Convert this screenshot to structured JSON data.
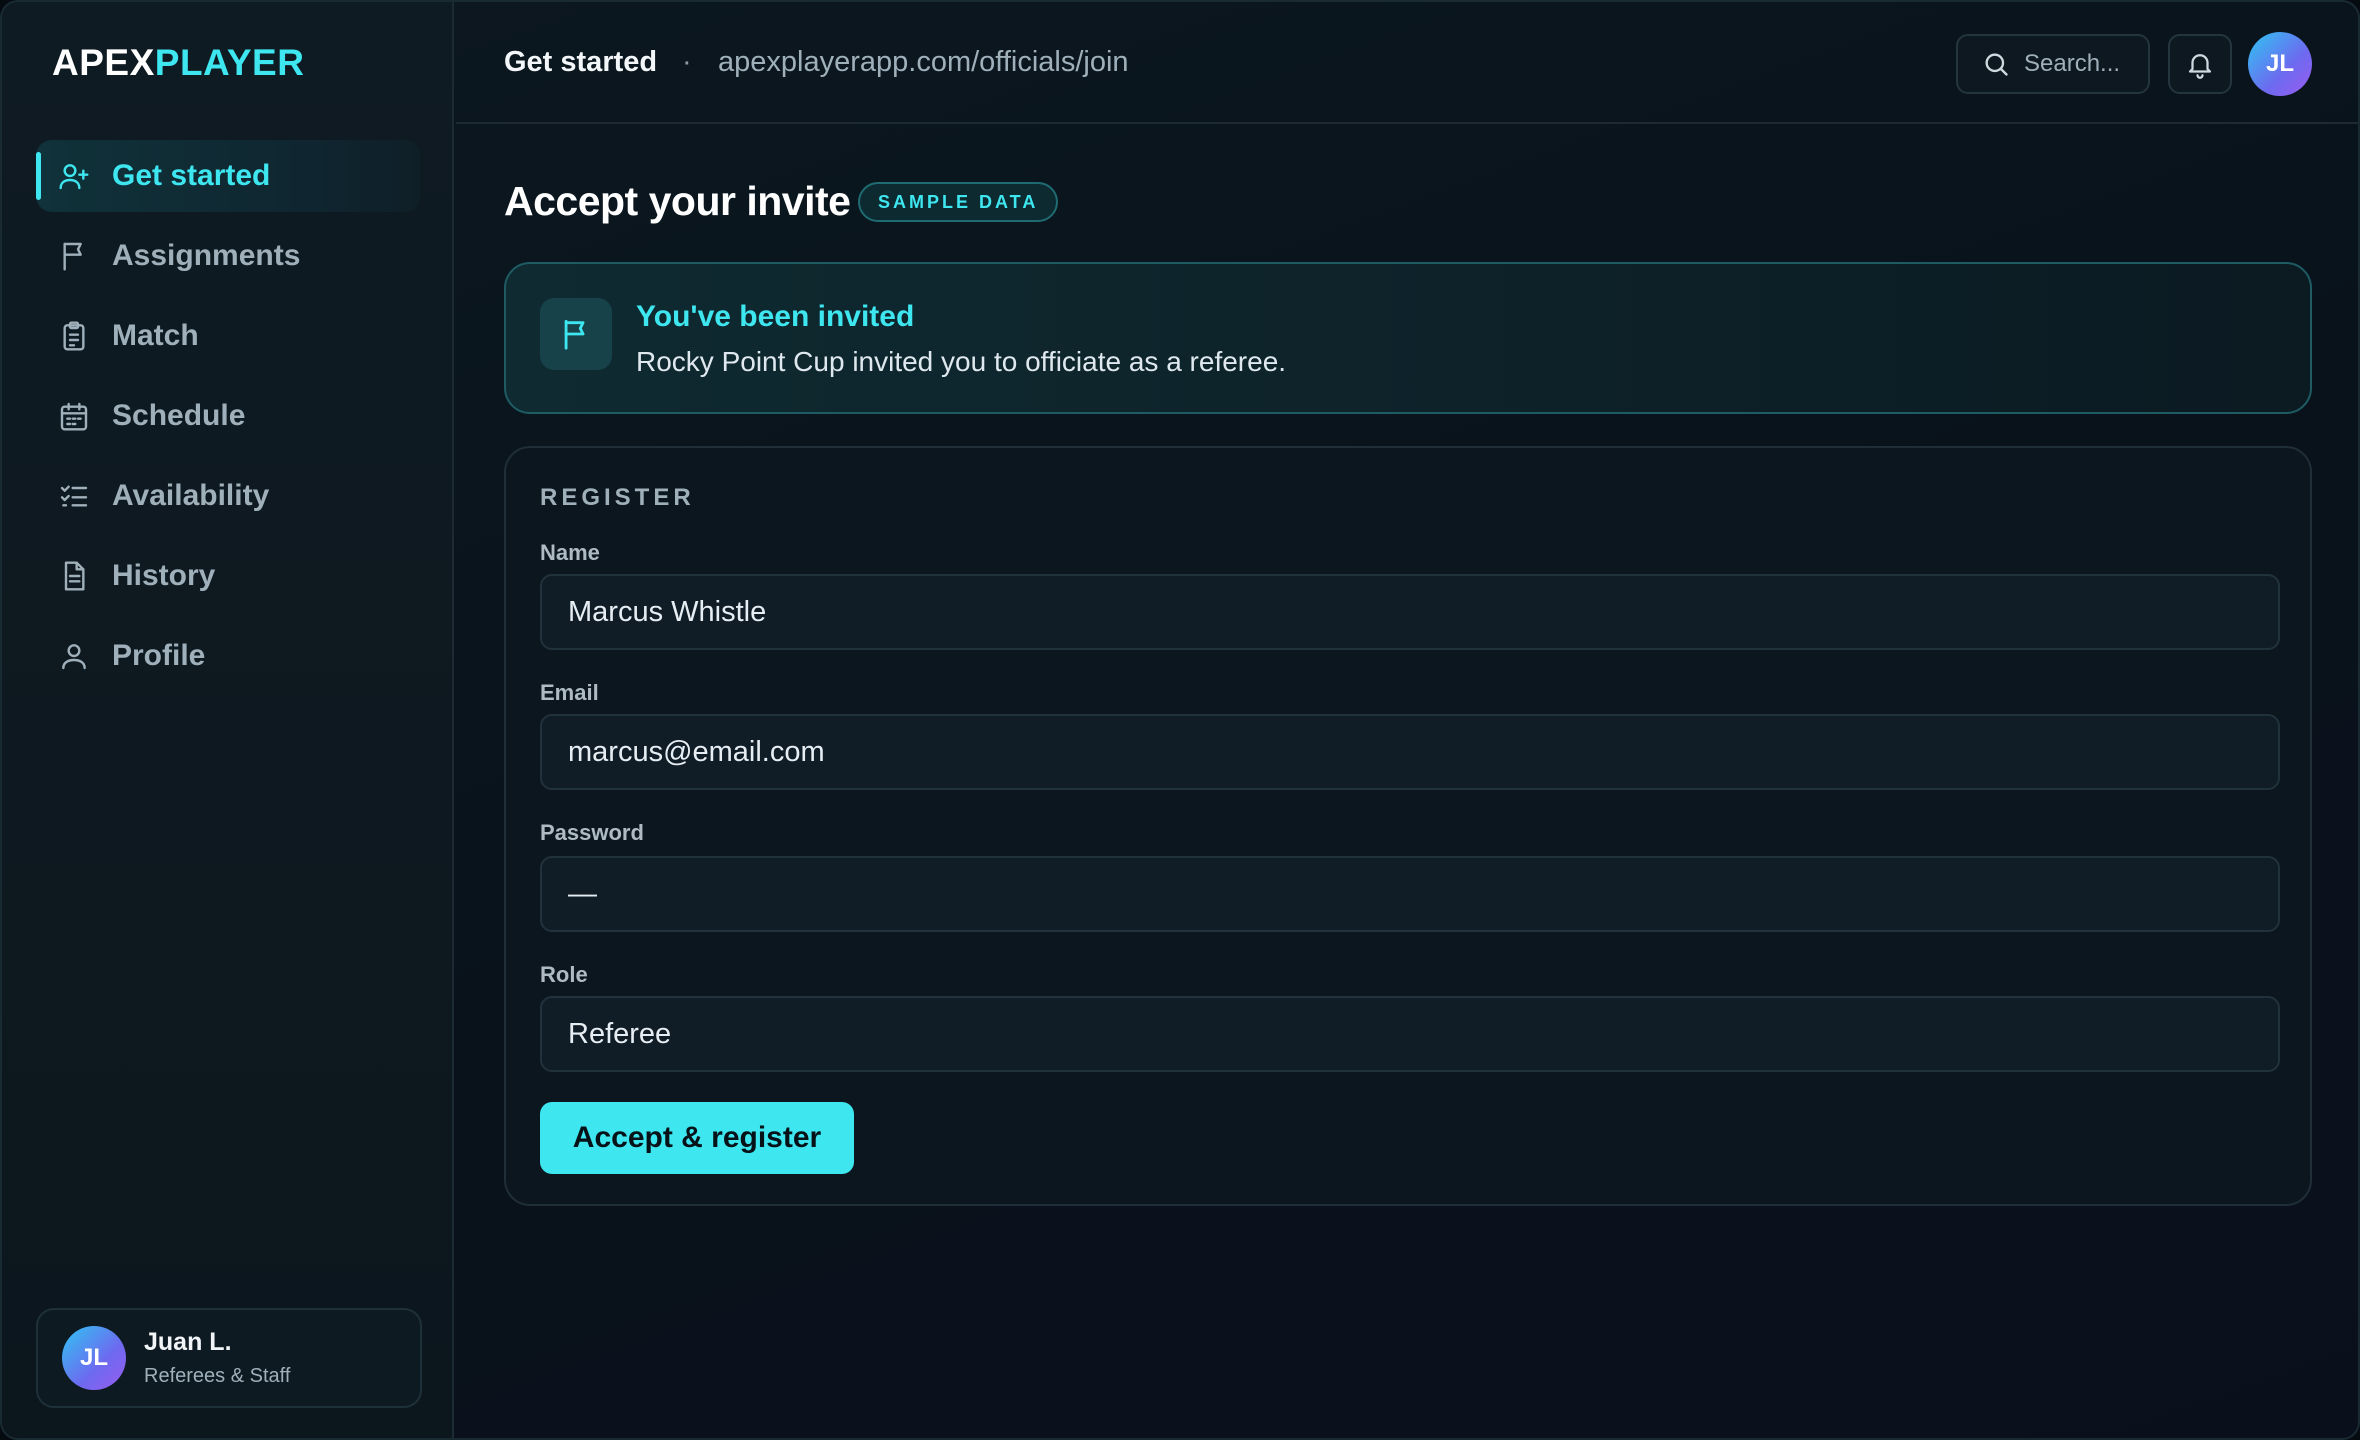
{
  "brand": {
    "part1": "APEX",
    "part2": "PLAYER"
  },
  "sidebar": {
    "items": [
      {
        "label": "Get started",
        "icon": "user-plus-icon",
        "active": true
      },
      {
        "label": "Assignments",
        "icon": "flag-icon",
        "active": false
      },
      {
        "label": "Match",
        "icon": "clipboard-icon",
        "active": false
      },
      {
        "label": "Schedule",
        "icon": "calendar-icon",
        "active": false
      },
      {
        "label": "Availability",
        "icon": "checklist-icon",
        "active": false
      },
      {
        "label": "History",
        "icon": "document-icon",
        "active": false
      },
      {
        "label": "Profile",
        "icon": "user-icon",
        "active": false
      }
    ],
    "user": {
      "initials": "JL",
      "name": "Juan L.",
      "role": "Referees & Staff"
    }
  },
  "header": {
    "title": "Get started",
    "separator": "·",
    "url": "apexplayerapp.com/officials/join",
    "search_placeholder": "Search...",
    "avatar_initials": "JL"
  },
  "main": {
    "title": "Accept your invite",
    "badge": "SAMPLE DATA",
    "invite": {
      "title": "You've been invited",
      "message": "Rocky Point Cup invited you to officiate as a referee."
    },
    "register": {
      "section_label": "REGISTER",
      "fields": [
        {
          "label": "Name",
          "value": "Marcus Whistle"
        },
        {
          "label": "Email",
          "value": "marcus@email.com"
        },
        {
          "label": "Password",
          "value": "—"
        },
        {
          "label": "Role",
          "value": "Referee"
        }
      ],
      "submit_label": "Accept & register"
    }
  },
  "colors": {
    "accent": "#3ee6f0",
    "background": "#09131b",
    "sidebar": "#0f1b23"
  }
}
